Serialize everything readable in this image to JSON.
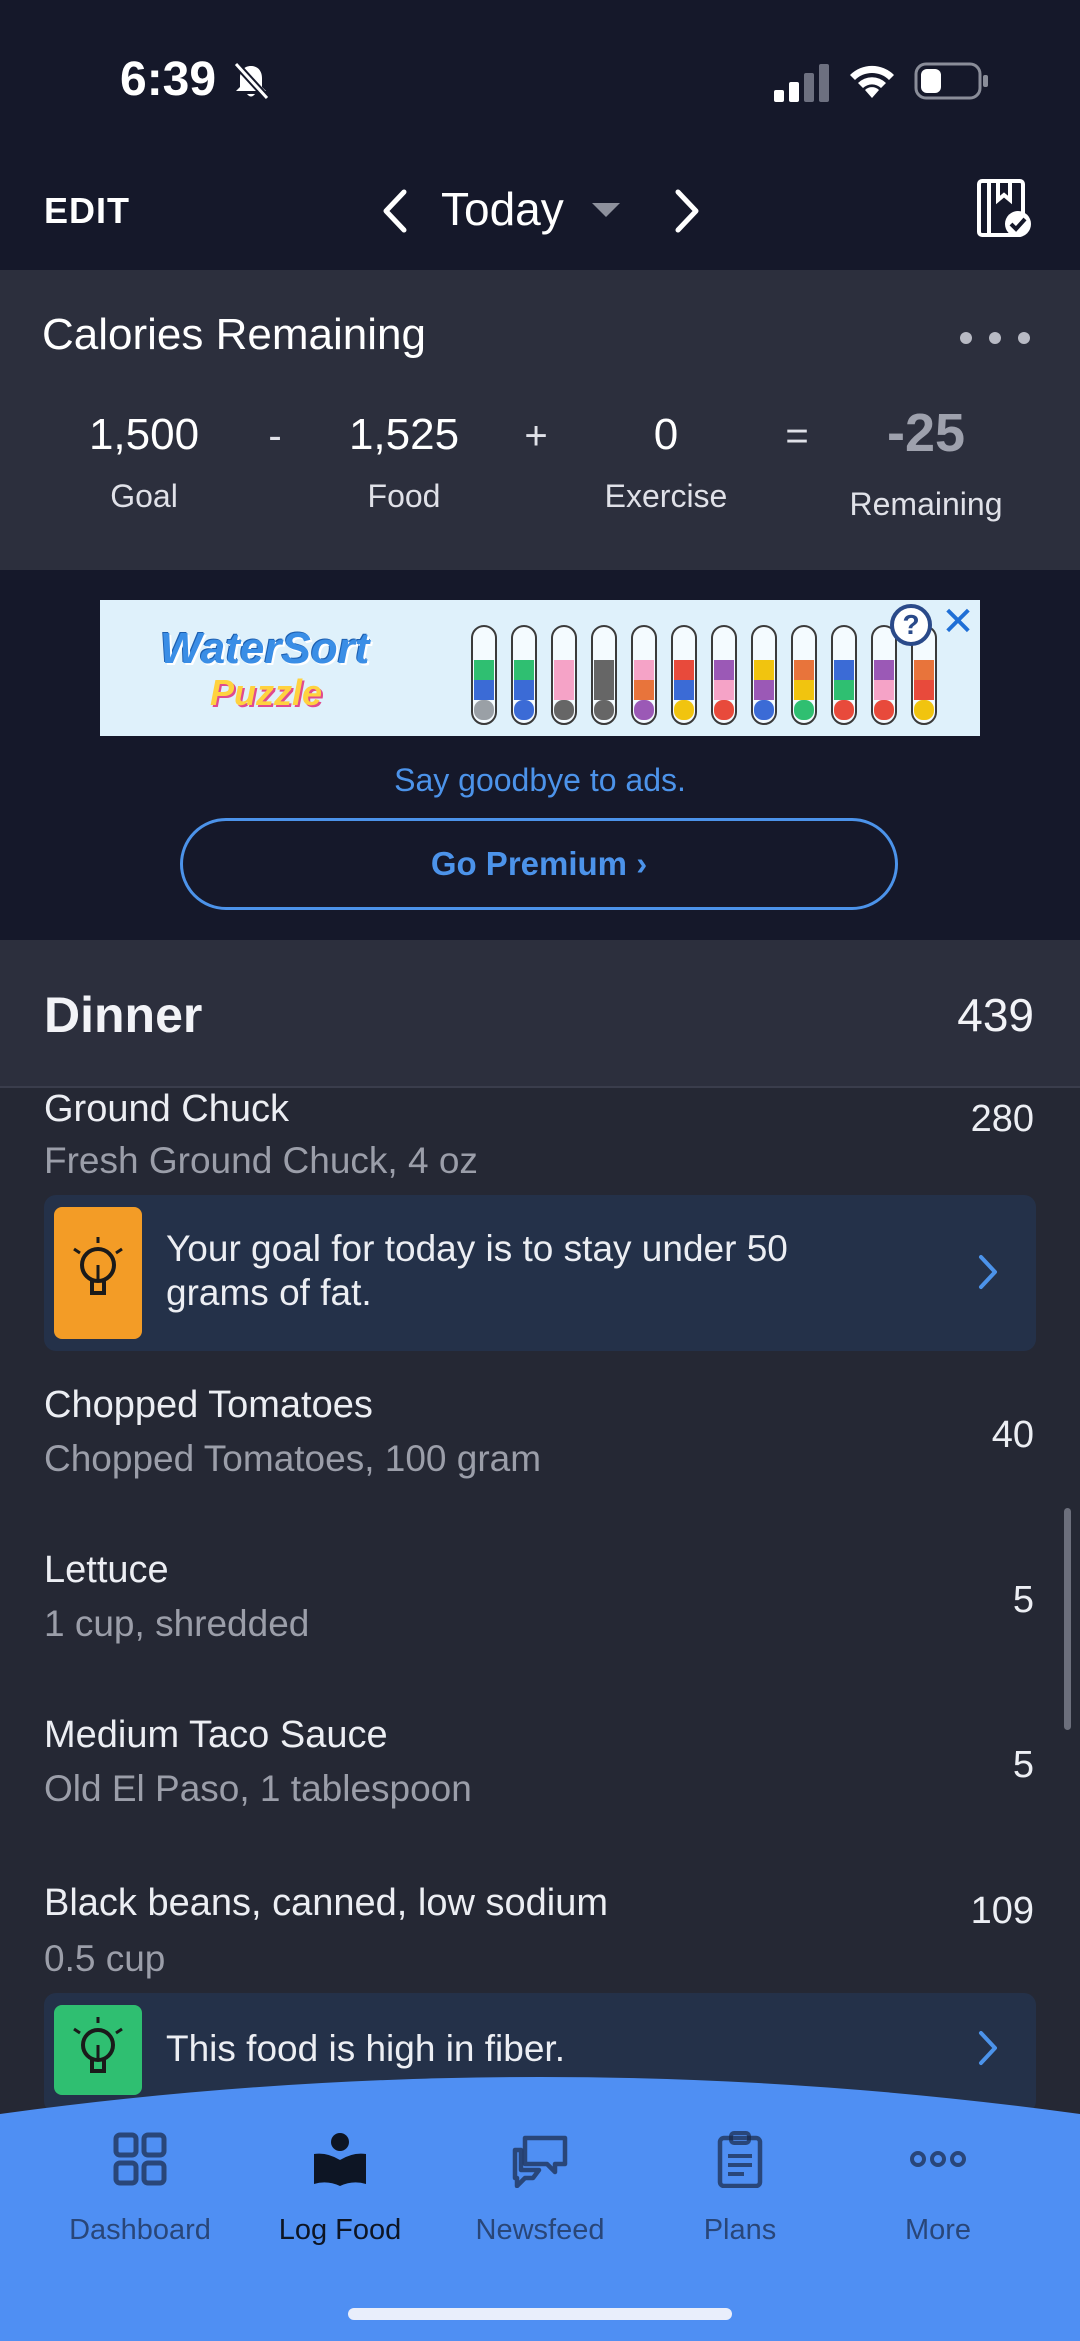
{
  "status_bar": {
    "time": "6:39"
  },
  "header": {
    "edit_label": "EDIT",
    "day_label": "Today"
  },
  "calories": {
    "title": "Calories Remaining",
    "goal_value": "1,500",
    "goal_label": "Goal",
    "op_minus": "-",
    "food_value": "1,525",
    "food_label": "Food",
    "op_plus": "+",
    "exercise_value": "0",
    "exercise_label": "Exercise",
    "op_equals": "=",
    "remaining_value": "-25",
    "remaining_label": "Remaining"
  },
  "ad": {
    "logo_line1": "WaterSort",
    "logo_line2": "Puzzle",
    "info_glyph": "?",
    "close_glyph": "✕",
    "promo_text": "Say goodbye to ads.",
    "premium_label": "Go Premium ›"
  },
  "dinner": {
    "title": "Dinner",
    "total": "439",
    "items": [
      {
        "name": "Ground Chuck",
        "desc": "Fresh Ground Chuck, 4 oz",
        "calories": "280"
      },
      {
        "name": "Chopped Tomatoes",
        "desc": "Chopped Tomatoes, 100 gram",
        "calories": "40"
      },
      {
        "name": "Lettuce",
        "desc": "1 cup, shredded",
        "calories": "5"
      },
      {
        "name": "Medium Taco Sauce",
        "desc": "Old El Paso, 1 tablespoon",
        "calories": "5"
      },
      {
        "name": "Black beans, canned, low sodium",
        "desc": "0.5 cup",
        "calories": "109"
      }
    ],
    "tips": [
      {
        "line1": "Your goal for today is to stay under 50",
        "line2": "grams of fat.",
        "color": "#f39c26"
      },
      {
        "line1": "This food is high in fiber.",
        "color": "#2fbf71"
      }
    ]
  },
  "tab_bar": {
    "tabs": [
      {
        "label": "Dashboard",
        "icon": "dashboard-icon"
      },
      {
        "label": "Log Food",
        "icon": "log-food-icon",
        "active": true
      },
      {
        "label": "Newsfeed",
        "icon": "newsfeed-icon"
      },
      {
        "label": "Plans",
        "icon": "plans-icon"
      },
      {
        "label": "More",
        "icon": "more-icon"
      }
    ],
    "color": "#4f8ff3"
  }
}
